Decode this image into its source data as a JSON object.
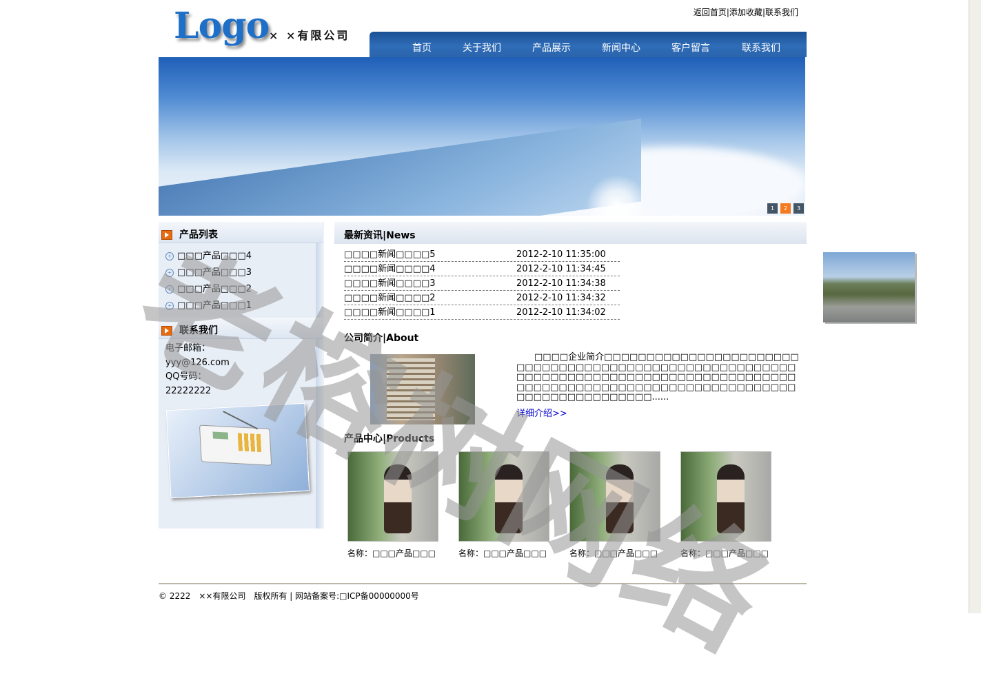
{
  "header": {
    "logo": "Logo",
    "company": "× ×有限公司",
    "toplinks": [
      "返回首页",
      "添加收藏",
      "联系我们"
    ],
    "nav": [
      "首页",
      "关于我们",
      "产品展示",
      "新闻中心",
      "客户留言",
      "联系我们"
    ]
  },
  "banner": {
    "slides": [
      "1",
      "2",
      "3"
    ],
    "active_slide": "2"
  },
  "sidebar": {
    "products_title": "产品列表",
    "products": [
      "□□□产品□□□4",
      "□□□产品□□□3",
      "□□□产品□□□2",
      "□□□产品□□□1"
    ],
    "contact_title": "联系我们",
    "contact": [
      "电子邮箱：",
      "yyy@126.com",
      "QQ号码：",
      "22222222"
    ]
  },
  "news": {
    "title": "最新资讯|News",
    "items": [
      {
        "title": "□□□□新闻□□□□5",
        "date": "2012-2-10 11:35:00"
      },
      {
        "title": "□□□□新闻□□□□4",
        "date": "2012-2-10 11:34:45"
      },
      {
        "title": "□□□□新闻□□□□3",
        "date": "2012-2-10 11:34:38"
      },
      {
        "title": "□□□□新闻□□□□2",
        "date": "2012-2-10 11:34:32"
      },
      {
        "title": "□□□□新闻□□□□1",
        "date": "2012-2-10 11:34:02"
      }
    ]
  },
  "about": {
    "title": "公司简介|About",
    "text": "　　□□□□企业简介□□□□□□□□□□□□□□□□□□□□□□□□□□□□□□□□□□□□□□□□□□□□□□□□□□□□□□□□□□□□□□□□□□□□□□□□□□□□□□□□□□□□□□□□□□□□□□□□□□□□□□□□□□□□□□□□□□□□□□□□□□□□□□□□□□□□□□□□□□......",
    "more": "详细介绍>>"
  },
  "products": {
    "title": "产品中心|Products",
    "items": [
      "名称：□□□产品□□□",
      "名称：□□□产品□□□",
      "名称：□□□产品□□□",
      "名称：□□□产品□□□"
    ]
  },
  "footer": {
    "text": "© 2222　××有限公司　版权所有 | 网站备案号:□ICP备00000000号"
  },
  "watermark": "老榕树网络"
}
